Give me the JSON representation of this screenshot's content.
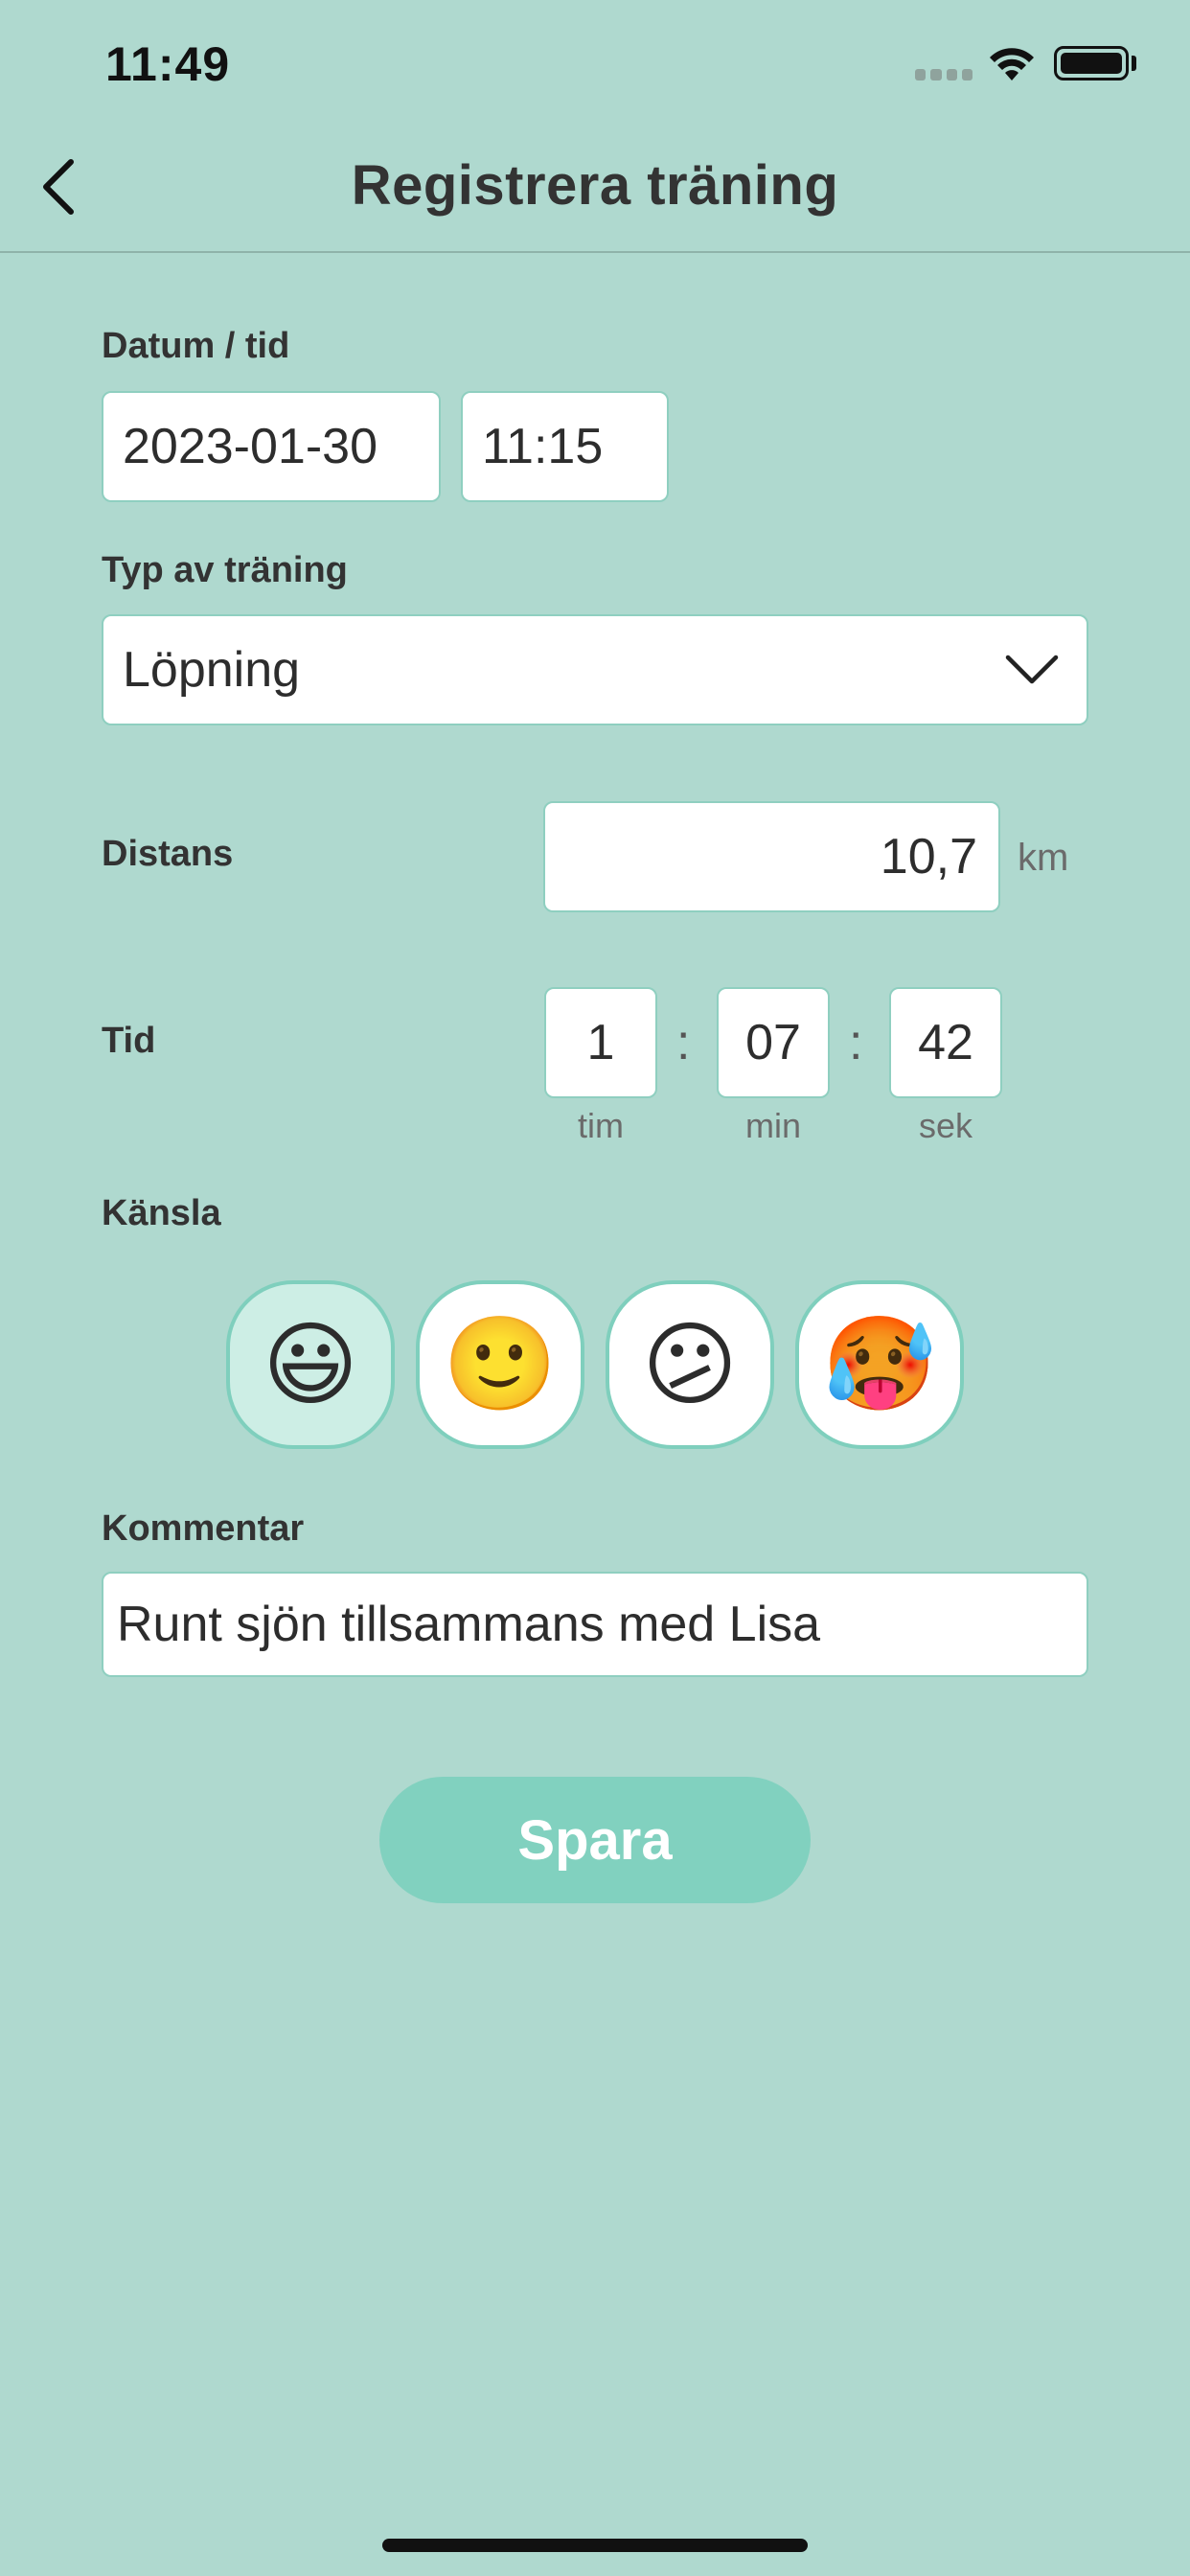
{
  "status_bar": {
    "time": "11:49"
  },
  "nav": {
    "title": "Registrera träning"
  },
  "form": {
    "datetime_label": "Datum / tid",
    "date_value": "2023-01-30",
    "time_value": "11:15",
    "type_label": "Typ av träning",
    "type_value": "Löpning",
    "distance_label": "Distans",
    "distance_value": "10,7",
    "distance_unit": "km",
    "duration_label": "Tid",
    "duration": {
      "hours": "1",
      "hours_unit": "tim",
      "minutes": "07",
      "minutes_unit": "min",
      "seconds": "42",
      "seconds_unit": "sek",
      "separator": ":"
    },
    "feeling_label": "Känsla",
    "feelings": [
      {
        "emoji": "😃",
        "icon": "grinning-face-icon",
        "selected": true
      },
      {
        "emoji": "🙂",
        "icon": "slightly-smiling-face-icon",
        "selected": false
      },
      {
        "emoji": "😕",
        "icon": "confused-face-icon",
        "selected": false
      },
      {
        "emoji": "🥵",
        "icon": "hot-face-icon",
        "selected": false
      }
    ],
    "comment_label": "Kommentar",
    "comment_value": "Runt sjön tillsammans med Lisa",
    "save_label": "Spara"
  },
  "colors": {
    "background": "#afd9cf",
    "accent": "#81d1bf",
    "selected_feeling": "#cdeee5"
  }
}
